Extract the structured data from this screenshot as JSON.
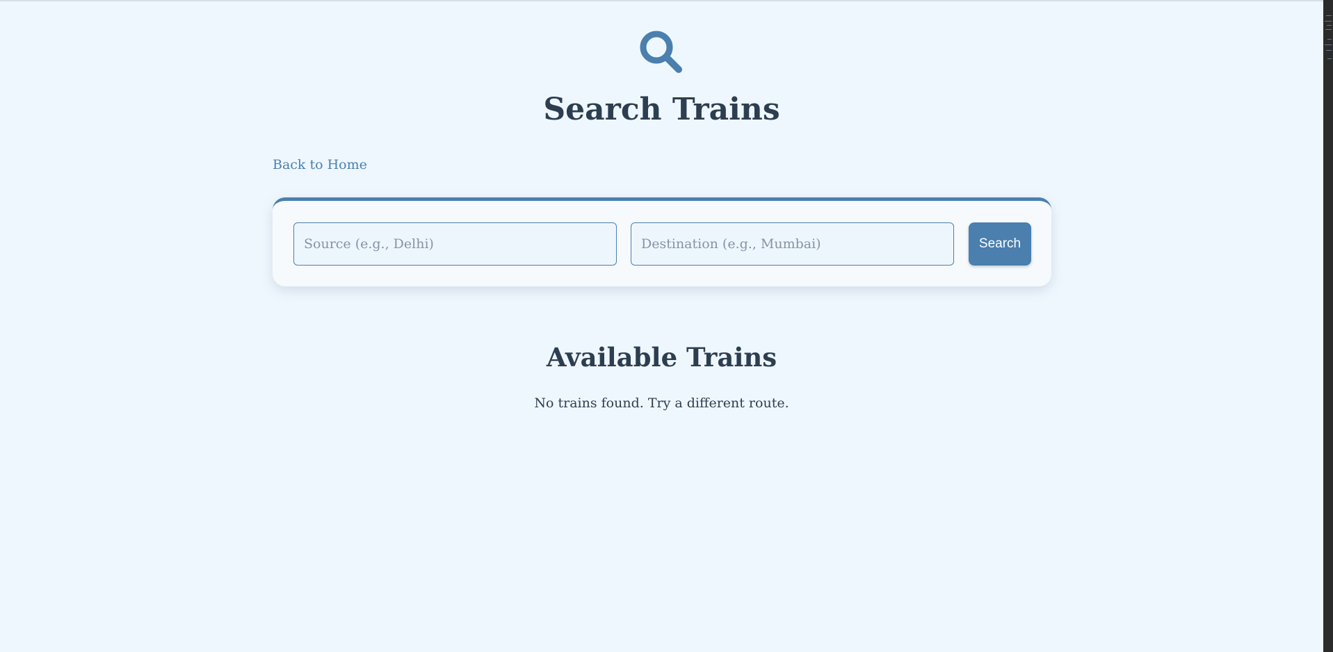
{
  "header": {
    "icon": "search-icon",
    "title": "Search Trains"
  },
  "nav": {
    "back_label": "Back to Home"
  },
  "search": {
    "source_placeholder": "Source (e.g., Delhi)",
    "source_value": "",
    "destination_placeholder": "Destination (e.g., Mumbai)",
    "destination_value": "",
    "button_label": "Search"
  },
  "results": {
    "title": "Available Trains",
    "empty_message": "No trains found. Try a different route."
  },
  "theme": {
    "background": "#eff7fe",
    "accent": "#4a7fae",
    "heading": "#2c3e50"
  }
}
